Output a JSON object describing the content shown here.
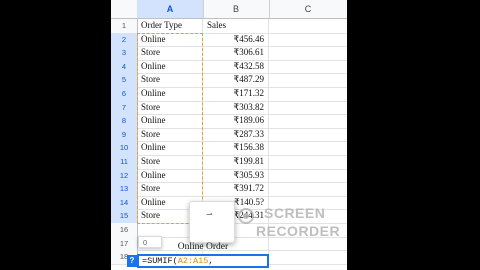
{
  "columns": [
    "A",
    "B",
    "C"
  ],
  "selected_column": "A",
  "rows": [
    {
      "n": "1",
      "a": "Order Type",
      "b": "Sales",
      "header": true
    },
    {
      "n": "2",
      "a": "Online",
      "b": "₹456.46"
    },
    {
      "n": "3",
      "a": "Store",
      "b": "₹306.61"
    },
    {
      "n": "4",
      "a": "Online",
      "b": "₹432.58"
    },
    {
      "n": "5",
      "a": "Store",
      "b": "₹487.29"
    },
    {
      "n": "6",
      "a": "Online",
      "b": "₹171.32"
    },
    {
      "n": "7",
      "a": "Store",
      "b": "₹303.82"
    },
    {
      "n": "8",
      "a": "Online",
      "b": "₹189.06"
    },
    {
      "n": "9",
      "a": "Store",
      "b": "₹287.33"
    },
    {
      "n": "10",
      "a": "Online",
      "b": "₹156.38"
    },
    {
      "n": "11",
      "a": "Store",
      "b": "₹199.81"
    },
    {
      "n": "12",
      "a": "Online",
      "b": "₹305.93"
    },
    {
      "n": "13",
      "a": "Store",
      "b": "₹391.72"
    },
    {
      "n": "14",
      "a": "Online",
      "b": "₹140.5?"
    },
    {
      "n": "15",
      "a": "Store",
      "b": "₹244.31"
    },
    {
      "n": "16",
      "a": "",
      "b": ""
    },
    {
      "n": "17",
      "a": "",
      "b": ""
    },
    {
      "n": "18",
      "a": "",
      "b": ""
    }
  ],
  "result_label": "Online Order",
  "formula": {
    "prefix": "=SUMIF(",
    "range": "A2:A15",
    "suffix": ","
  },
  "help_badge": "?",
  "preview_chip": "0",
  "popup_arrow": "⇀",
  "watermark": {
    "line1": "SCREEN",
    "line2": "RECORDER"
  },
  "colors": {
    "selection": "#d3e3fd",
    "formula_border": "#1a73e8",
    "range_highlight": "#e3a32b"
  }
}
